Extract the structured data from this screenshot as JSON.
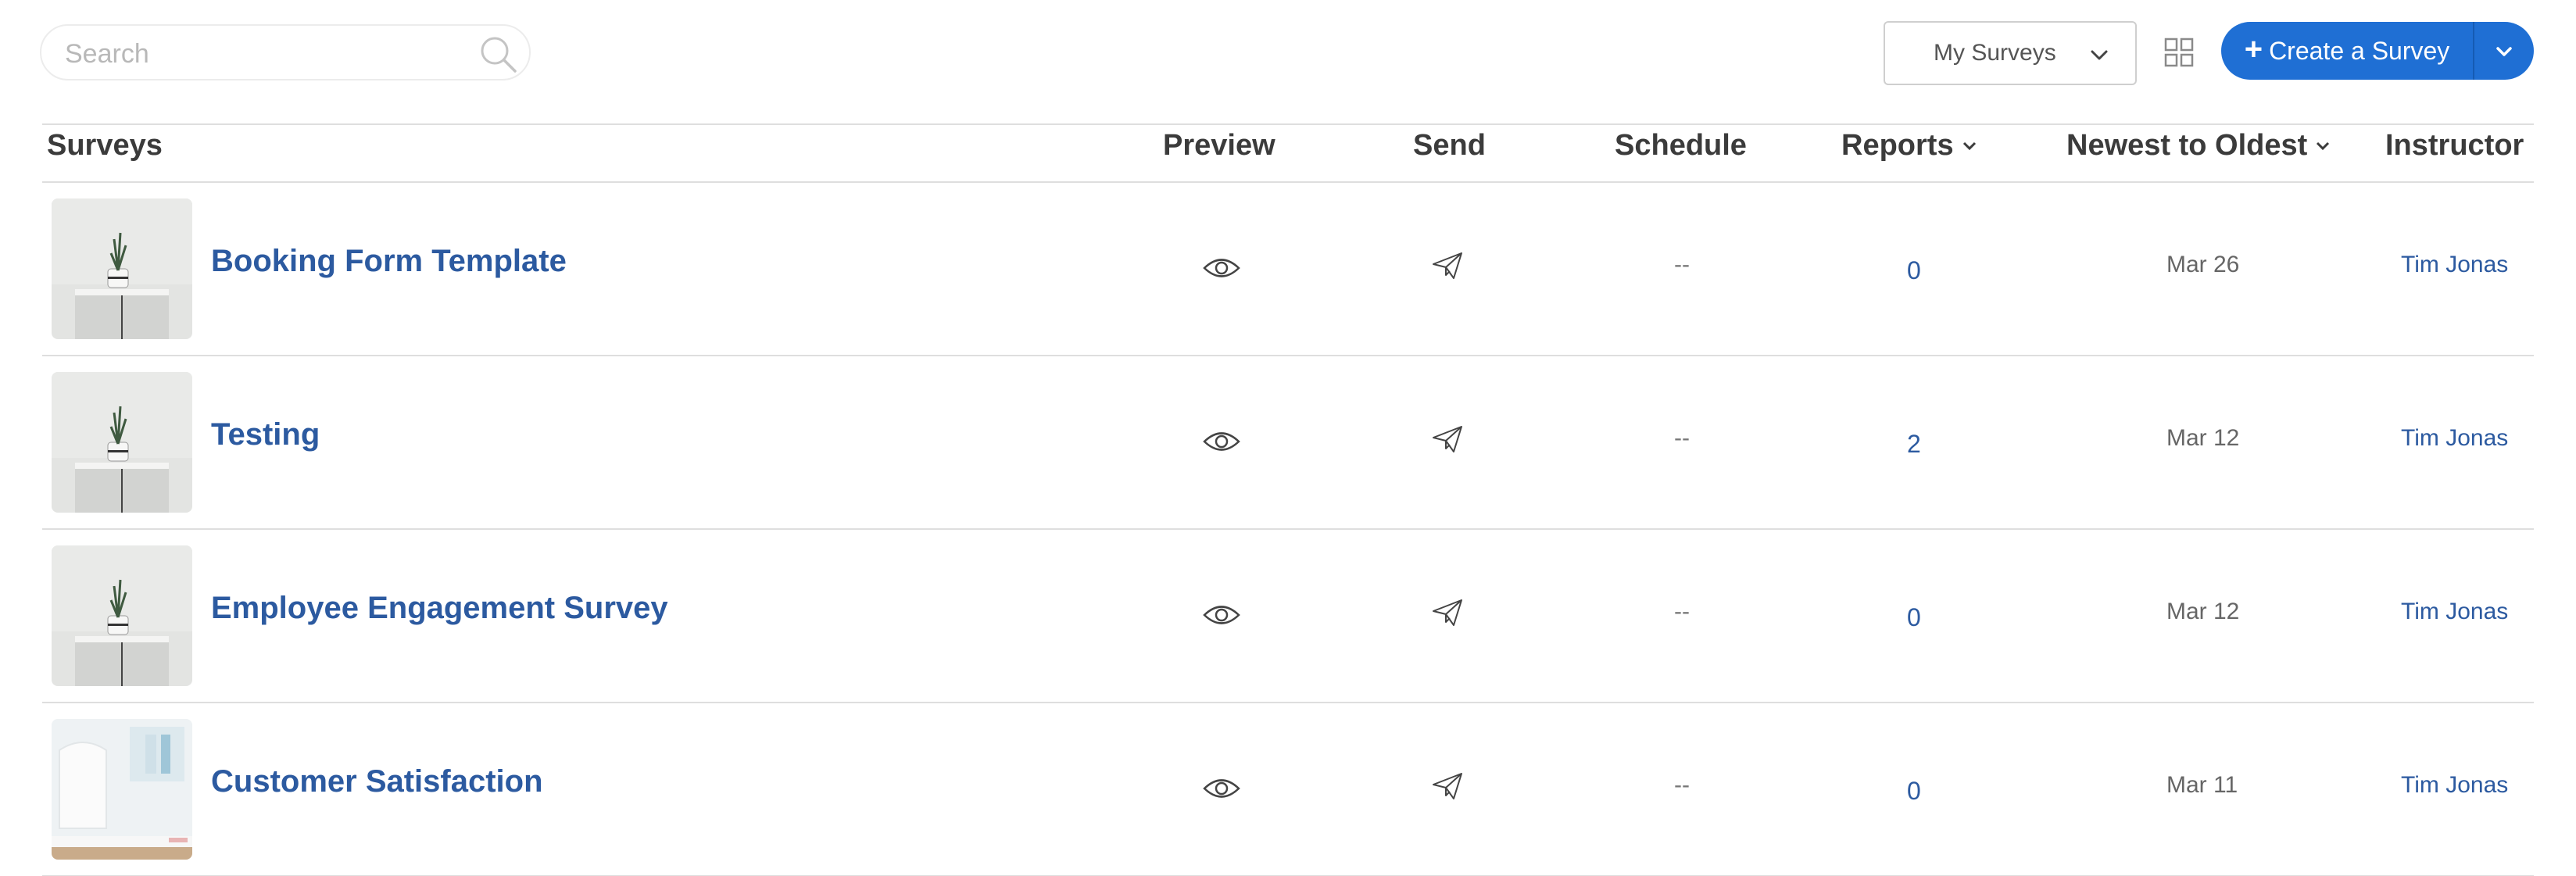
{
  "toolbar": {
    "search_placeholder": "Search",
    "filter_selected": "My Surveys",
    "create_label": "Create a Survey"
  },
  "table": {
    "headers": {
      "surveys": "Surveys",
      "preview": "Preview",
      "send": "Send",
      "schedule": "Schedule",
      "reports": "Reports",
      "sort": "Newest to Oldest",
      "instructor": "Instructor"
    },
    "rows": [
      {
        "title": "Booking Form Template",
        "schedule": "--",
        "reports": "0",
        "date": "Mar 26",
        "instructor": "Tim Jonas",
        "thumbnail": "plant-on-white-cabinet"
      },
      {
        "title": "Testing",
        "schedule": "--",
        "reports": "2",
        "date": "Mar 12",
        "instructor": "Tim Jonas",
        "thumbnail": "plant-on-white-cabinet"
      },
      {
        "title": "Employee Engagement Survey",
        "schedule": "--",
        "reports": "0",
        "date": "Mar 12",
        "instructor": "Tim Jonas",
        "thumbnail": "plant-on-white-cabinet"
      },
      {
        "title": "Customer Satisfaction",
        "schedule": "--",
        "reports": "0",
        "date": "Mar 11",
        "instructor": "Tim Jonas",
        "thumbnail": "white-office-desk"
      }
    ]
  },
  "colors": {
    "accent": "#1f6fd4",
    "link": "#2c5aa0",
    "divider": "#dedede"
  }
}
